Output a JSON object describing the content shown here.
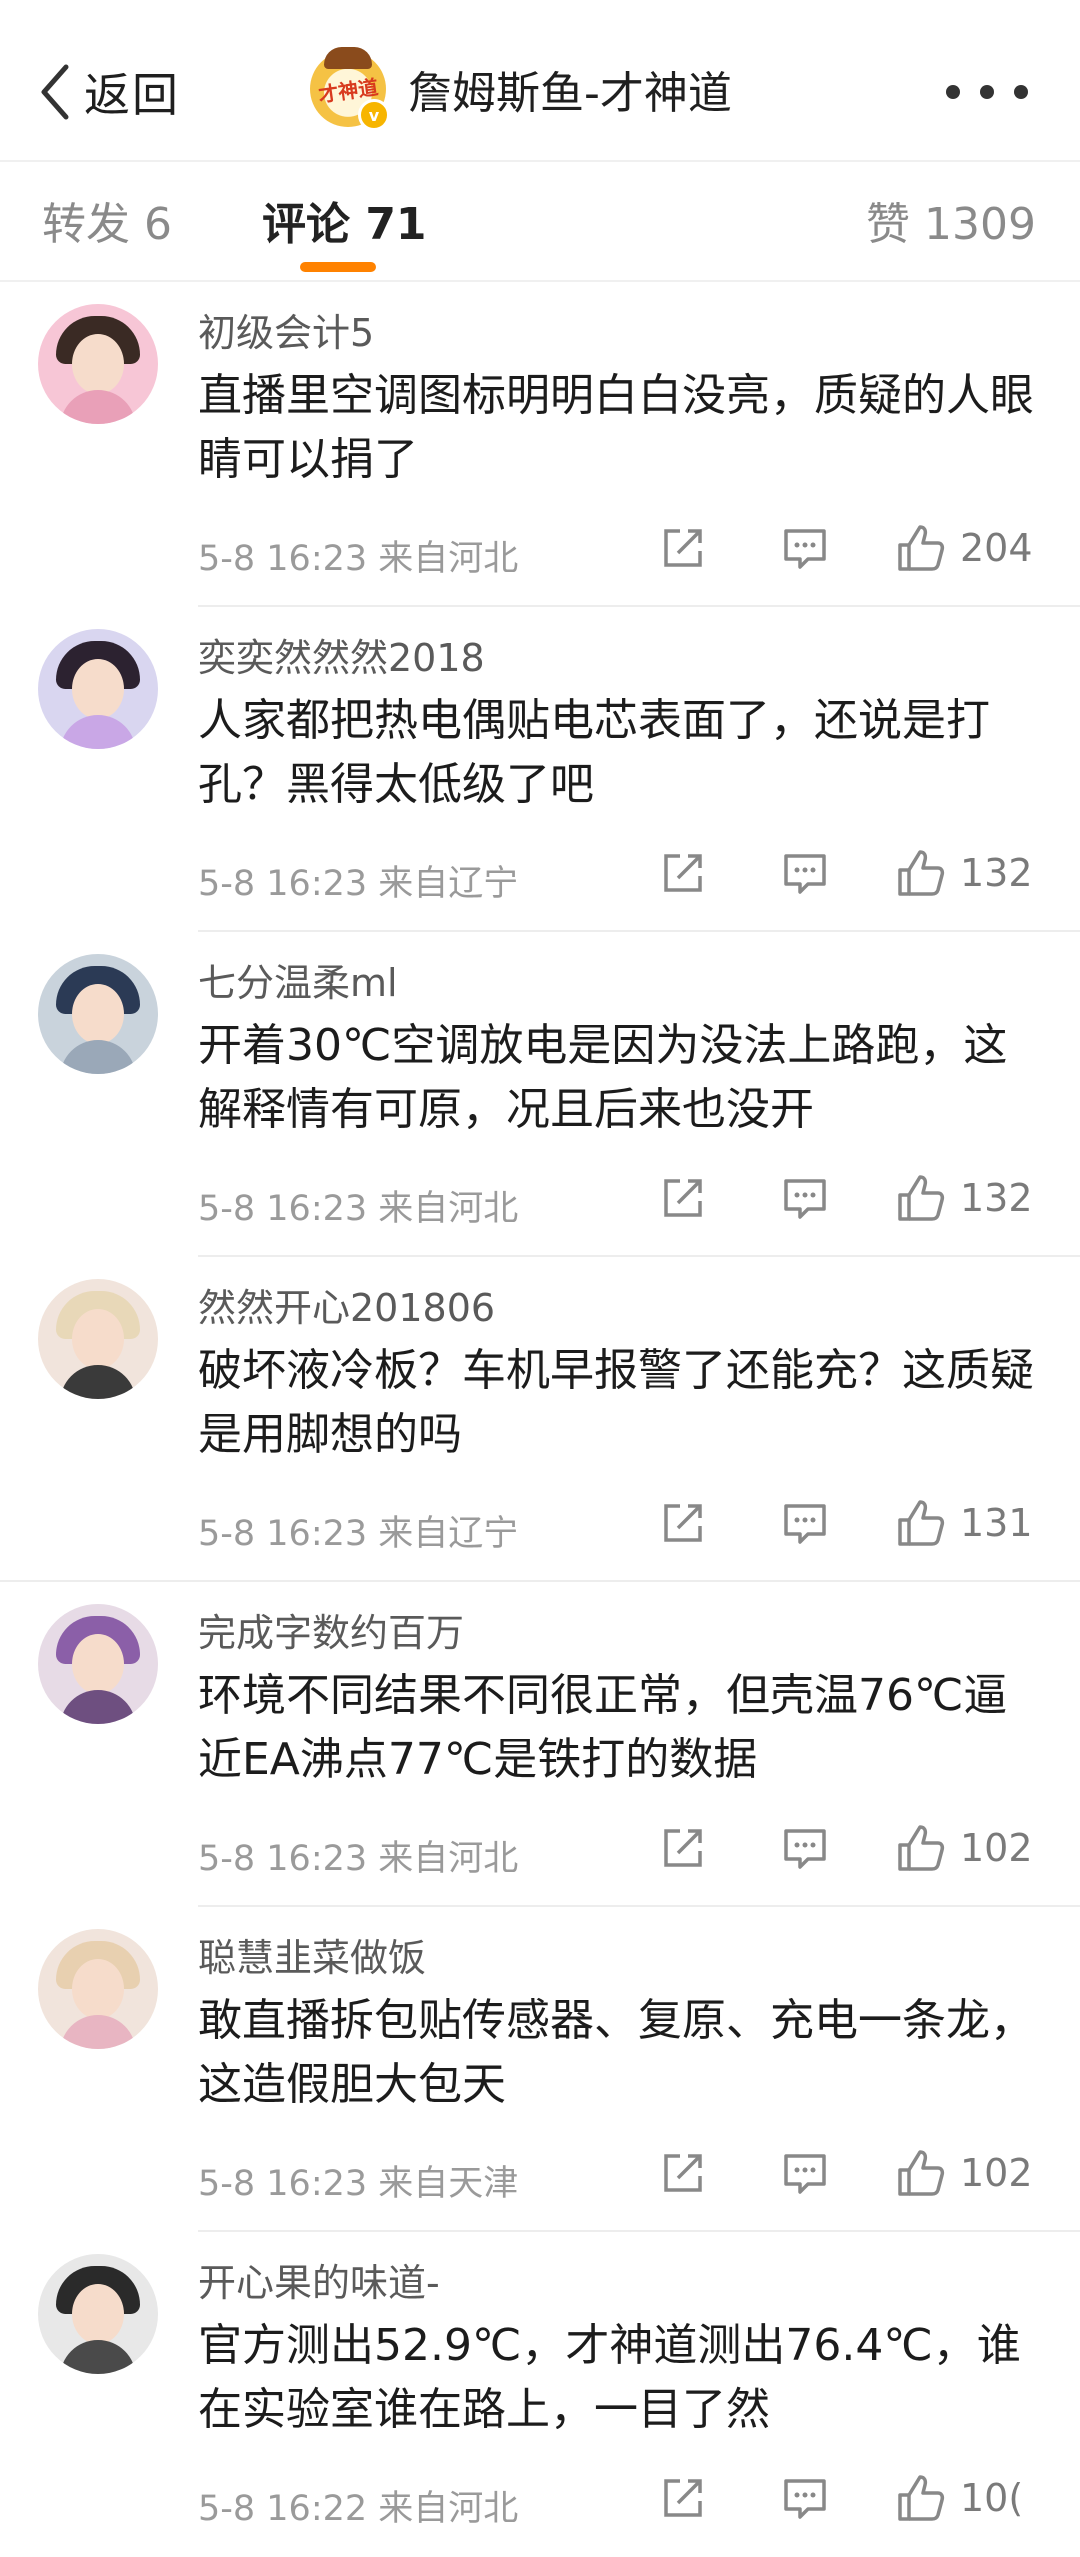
{
  "header": {
    "back_label": "返回",
    "title": "詹姆斯鱼-才神道",
    "logo_text": "才神道"
  },
  "tabs": {
    "repost": "转发 6",
    "comments": "评论 71",
    "likes": "赞 1309"
  },
  "colors": {
    "accent": "#ff8200",
    "verified": "#f7b500"
  },
  "comments": [
    {
      "user": "初级会计5",
      "text": "直播里空调图标明明白白没亮，质疑的人眼睛可以捐了",
      "time": "5-8 16:23 来自河北",
      "likes": "204"
    },
    {
      "user": "奕奕然然然2018",
      "text": "人家都把热电偶贴电芯表面了，还说是打孔？黑得太低级了吧",
      "time": "5-8 16:23 来自辽宁",
      "likes": "132"
    },
    {
      "user": "七分温柔ml",
      "text": "开着30℃空调放电是因为没法上路跑，这解释情有可原，况且后来也没开",
      "time": "5-8 16:23 来自河北",
      "likes": "132"
    },
    {
      "user": "然然开心201806",
      "text": "破坏液冷板？车机早报警了还能充？这质疑是用脚想的吗",
      "time": "5-8 16:23 来自辽宁",
      "likes": "131"
    },
    {
      "user": "完成字数约百万",
      "text": "环境不同结果不同很正常，但壳温76℃逼近EA沸点77℃是铁打的数据",
      "time": "5-8 16:23 来自河北",
      "likes": "102"
    },
    {
      "user": "聪慧韭菜做饭",
      "text": "敢直播拆包贴传感器、复原、充电一条龙，这造假胆大包天",
      "time": "5-8 16:23 来自天津",
      "likes": "102"
    },
    {
      "user": "开心果的味道-",
      "text": "官方测出52.9℃，才神道测出76.4℃，谁在实验室谁在路上，一目了然",
      "time": "5-8 16:22 来自河北",
      "likes": "10("
    }
  ]
}
